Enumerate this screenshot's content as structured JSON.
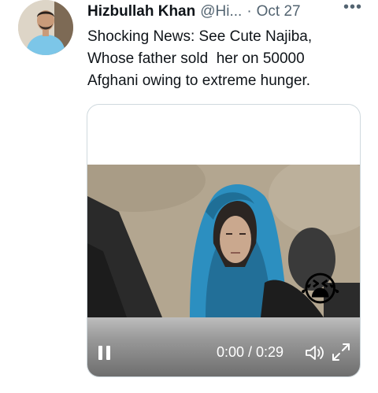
{
  "tweet": {
    "author_name": "Hizbullah Khan",
    "handle": "@Hi...",
    "separator": "·",
    "date": "Oct 27",
    "more_label": "•••",
    "text": "Shocking News: See Cute Najiba,\nWhose father sold  her on 50000\nAfghani owing to extreme hunger."
  },
  "media": {
    "emoji": "😭",
    "playback_state": "playing",
    "progress_fraction": 0.0,
    "time_display": "0:00 / 0:29"
  },
  "icons": {
    "avatar": "profile-photo",
    "more": "more-horizontal-icon",
    "pause": "pause-icon",
    "volume": "volume-icon",
    "fullscreen": "fullscreen-icon"
  },
  "colors": {
    "text_primary": "#0f1419",
    "text_secondary": "#536471",
    "card_border": "#cfd9de",
    "scarf_blue": "#2c8fc0"
  }
}
